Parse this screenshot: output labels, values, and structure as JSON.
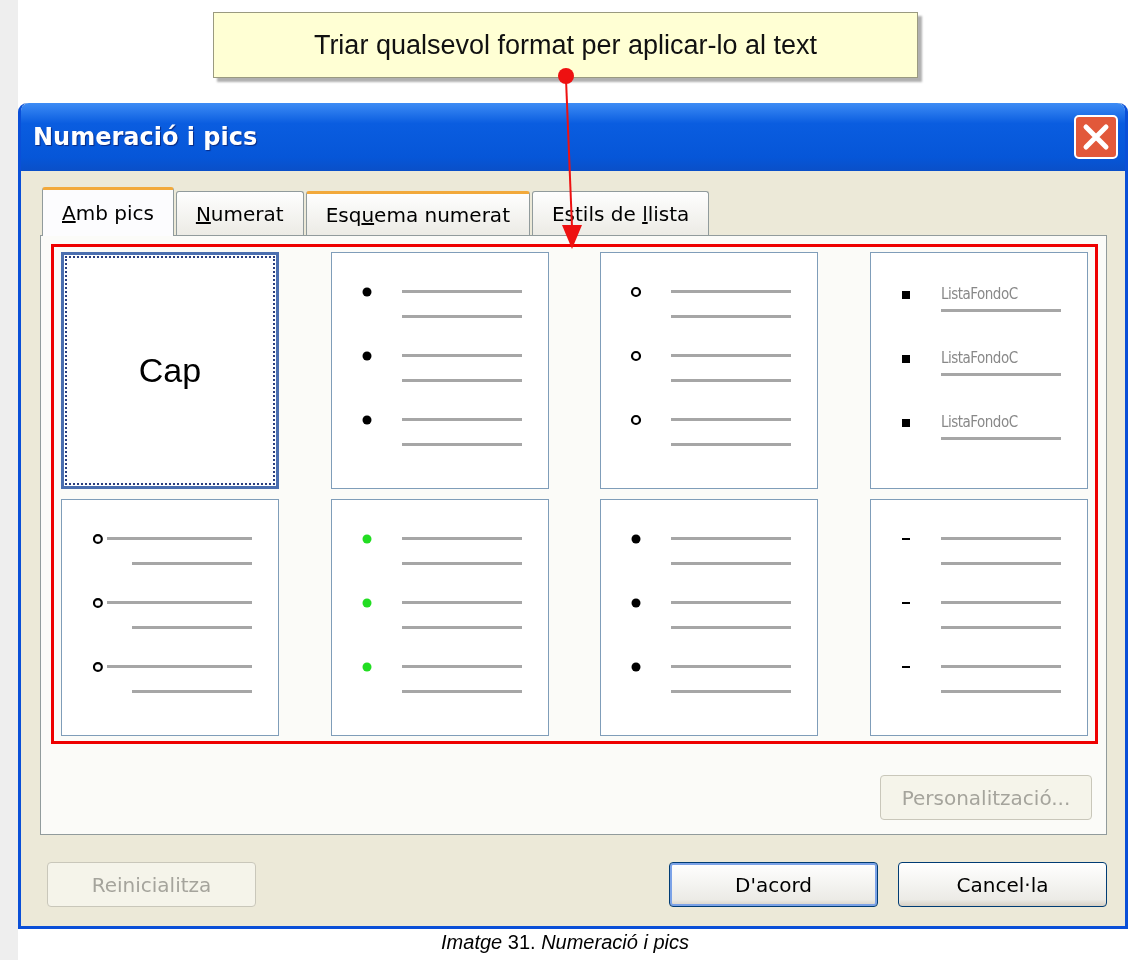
{
  "callout": {
    "text": "Triar qualsevol format per aplicar-lo al text"
  },
  "window": {
    "title": "Numeració i pics"
  },
  "tabs": [
    {
      "label": "Amb pics",
      "selected": true,
      "hot": false
    },
    {
      "label": "Numerat",
      "selected": false,
      "hot": false
    },
    {
      "label": "Esquema numerat",
      "selected": false,
      "hot": true
    },
    {
      "label": "Estils de llista",
      "selected": false,
      "hot": false
    }
  ],
  "options": [
    {
      "kind": "none",
      "label": "Cap",
      "selected": true
    },
    {
      "kind": "dot",
      "color": "#000000",
      "selected": false
    },
    {
      "kind": "circle",
      "color": "#000000",
      "selected": false
    },
    {
      "kind": "square",
      "color": "#000000",
      "selected": false,
      "items": [
        "ListaFondoC",
        "ListaFondoC",
        "ListaFondoC"
      ]
    },
    {
      "kind": "hanging",
      "color": "#000000",
      "selected": false
    },
    {
      "kind": "dot",
      "color": "#22dd22",
      "selected": false
    },
    {
      "kind": "dot",
      "color": "#000000",
      "selected": false
    },
    {
      "kind": "dash",
      "color": "#000000",
      "selected": false
    }
  ],
  "customize_button": {
    "label": "Personalització...",
    "disabled": true
  },
  "buttons": [
    {
      "label": "Reinicialitza",
      "disabled": true,
      "default": false
    },
    {
      "label": "D'acord",
      "disabled": false,
      "default": true
    },
    {
      "label": "Cancel·la",
      "disabled": false,
      "default": false
    }
  ],
  "caption": "*Imatge* 31. *Numeració i pics*"
}
